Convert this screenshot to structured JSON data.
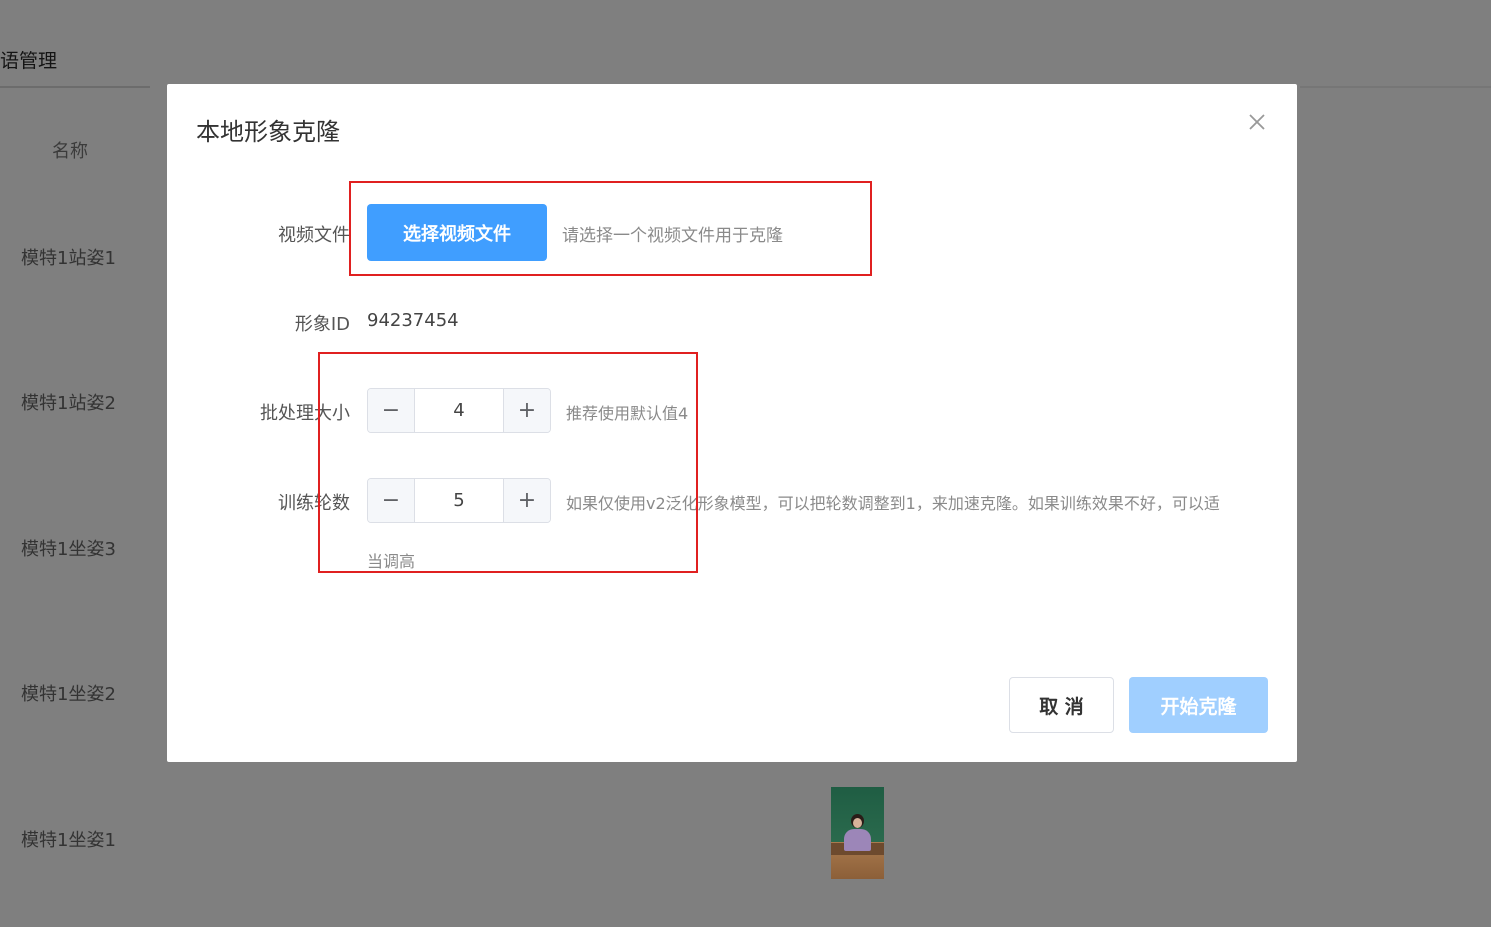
{
  "background": {
    "section_title": "语管理",
    "column_header": "名称",
    "rows": [
      "模特1站姿1",
      "模特1站姿2",
      "模特1坐姿3",
      "模特1坐姿2",
      "模特1坐姿1"
    ]
  },
  "dialog": {
    "title": "本地形象克隆",
    "close_icon": "close-icon",
    "video_file": {
      "label": "视频文件",
      "button_label": "选择视频文件",
      "hint": "请选择一个视频文件用于克隆"
    },
    "avatar_id": {
      "label": "形象ID",
      "value": "94237454"
    },
    "batch_size": {
      "label": "批处理大小",
      "value": "4",
      "hint": "推荐使用默认值4"
    },
    "epochs": {
      "label": "训练轮数",
      "value": "5",
      "hint_line1": "如果仅使用v2泛化形象模型，可以把轮数调整到1，来加速克隆。如果训练效果不好，可以适",
      "hint_line2": "当调高"
    },
    "stepper_minus": "−",
    "stepper_plus": "+",
    "cancel_label": "取 消",
    "start_label": "开始克隆"
  },
  "colors": {
    "primary": "#409eff",
    "primary_disabled": "#a0cfff",
    "highlight_box": "#e02020",
    "overlay": "#7f7f7f"
  }
}
